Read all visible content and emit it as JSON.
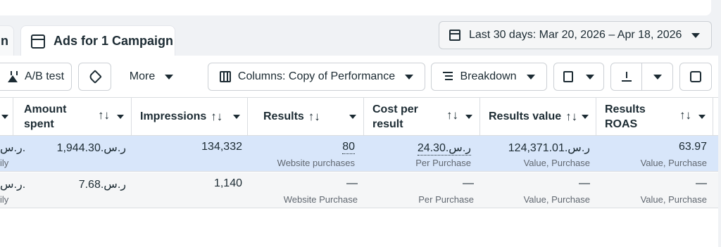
{
  "tabs": {
    "left_partial": "n",
    "main": "Ads for 1 Campaign"
  },
  "date_range": "Last 30 days: Mar 20, 2026 – Apr 18, 2026",
  "toolbar": {
    "ab_test": "A/B test",
    "more": "More",
    "columns": "Columns: Copy of Performance",
    "breakdown": "Breakdown"
  },
  "table": {
    "headers": {
      "amount_spent": [
        "Amount",
        "spent"
      ],
      "impressions": "Impressions",
      "results": "Results",
      "cost_per_result": [
        "Cost per",
        "result"
      ],
      "results_value": "Results value",
      "results_roas": [
        "Results",
        "ROAS"
      ],
      "sort_glyph": "↑↓"
    },
    "rows": [
      {
        "edge_value": "ر.س.",
        "edge_sub": "ily",
        "amount_spent": "1,944.30.ر.س",
        "impressions": "134,332",
        "results": "80",
        "results_sub": "Website purchases",
        "cost_per_result": "24.30.ر.س",
        "cost_sub": "Per Purchase",
        "results_value": "124,371.01.ر.س",
        "value_sub": "Value, Purchase",
        "roas": "63.97",
        "roas_sub": "Value, Purchase"
      },
      {
        "edge_value": "ر.س.",
        "edge_sub": "ily",
        "amount_spent": "7.68.ر.س",
        "impressions": "1,140",
        "results": "—",
        "results_sub": "Website Purchase",
        "cost_per_result": "—",
        "cost_sub": "Per Purchase",
        "results_value": "—",
        "value_sub": "Value, Purchase",
        "roas": "—",
        "roas_sub": "Value, Purchase"
      }
    ]
  },
  "colors": {
    "selected_row": "#d8e6fa",
    "border": "#dadde1",
    "text": "#1c2b33",
    "muted": "#606770"
  }
}
